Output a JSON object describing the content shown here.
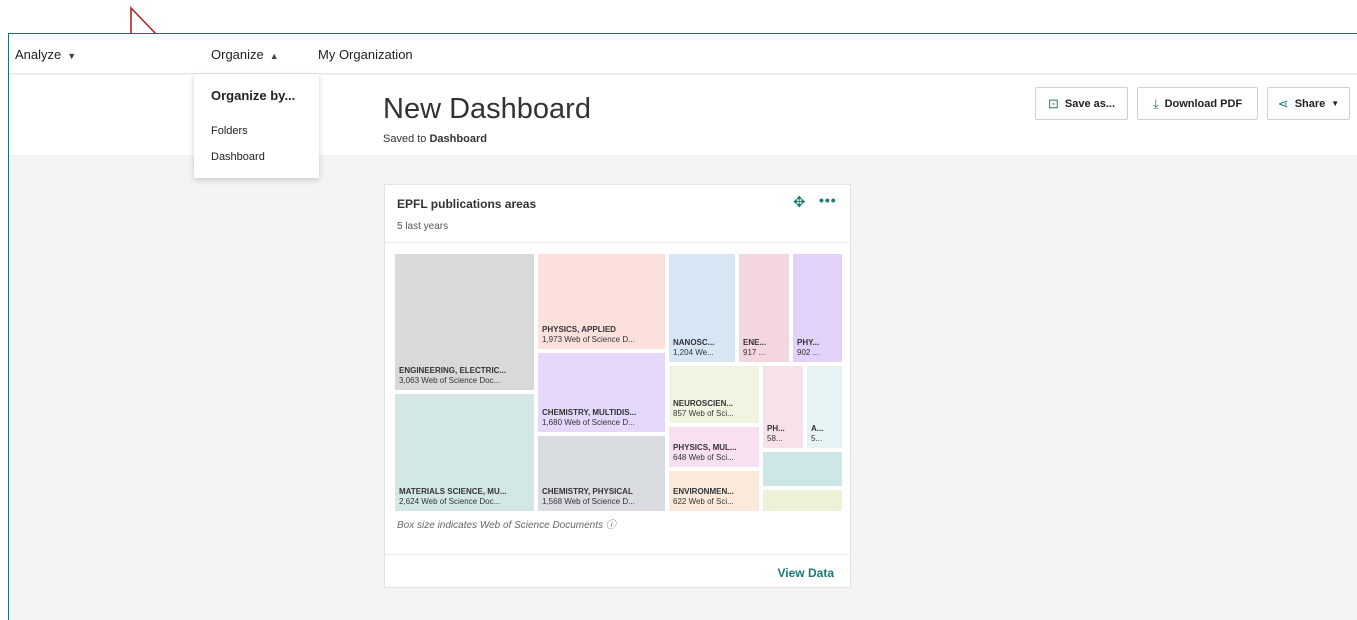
{
  "nav": {
    "analyze": "Analyze",
    "organize": "Organize",
    "my_org": "My Organization"
  },
  "dropdown": {
    "heading": "Organize by...",
    "items": [
      "Folders",
      "Dashboard"
    ]
  },
  "dashboard": {
    "title": "New Dashboard",
    "saved_prefix": "Saved to ",
    "saved_location": "Dashboard",
    "save_as": "Save as...",
    "download_pdf": "Download PDF",
    "share": "Share"
  },
  "card": {
    "title": "EPFL publications areas",
    "subtitle": "5 last years",
    "note": "Box size indicates Web of Science Documents ⓘ",
    "view_data": "View Data"
  },
  "chart_data": {
    "type": "treemap",
    "metric": "Web of Science Documents",
    "tiles": [
      {
        "label": "ENGINEERING, ELECTRIC...",
        "value_text": "3,063 Web of Science Doc...",
        "value": 3063,
        "color": "#d9d9d9"
      },
      {
        "label": "MATERIALS SCIENCE, MU...",
        "value_text": "2,624 Web of Science Doc...",
        "value": 2624,
        "color": "#d3e8e6"
      },
      {
        "label": "PHYSICS, APPLIED",
        "value_text": "1,973 Web of Science D...",
        "value": 1973,
        "color": "#fbe0dc"
      },
      {
        "label": "CHEMISTRY, MULTIDIS...",
        "value_text": "1,680 Web of Science D...",
        "value": 1680,
        "color": "#e5d8fb"
      },
      {
        "label": "CHEMISTRY, PHYSICAL",
        "value_text": "1,568 Web of Science D...",
        "value": 1568,
        "color": "#d9dde2"
      },
      {
        "label": "NANOSC...",
        "value_text": "1,204 We...",
        "value": 1204,
        "color": "#d6e6f4"
      },
      {
        "label": "ENE...",
        "value_text": "917 ...",
        "value": 917,
        "color": "#f4d7de"
      },
      {
        "label": "PHY...",
        "value_text": "902 ...",
        "value": 902,
        "color": "#e2d1f9"
      },
      {
        "label": "NEUROSCIEN...",
        "value_text": "857 Web of Sci...",
        "value": 857,
        "color": "#f2f4e1"
      },
      {
        "label": "PHYSICS, MUL...",
        "value_text": "648 Web of Sci...",
        "value": 648,
        "color": "#f8dff2"
      },
      {
        "label": "ENVIRONMEN...",
        "value_text": "622 Web of Sci...",
        "value": 622,
        "color": "#fbeadb"
      },
      {
        "label": "PH...",
        "value_text": "58...",
        "value": null,
        "color": "#f7e2ec"
      },
      {
        "label": "A...",
        "value_text": "5...",
        "value": null,
        "color": "#e6f2f3"
      },
      {
        "label": "",
        "value_text": "",
        "value": null,
        "color": "#cde6e6"
      },
      {
        "label": "",
        "value_text": "",
        "value": null,
        "color": "#eef1d8"
      }
    ]
  },
  "colors": {
    "accent": "#1a7a74",
    "annotation_arrow": "#b3262c"
  }
}
